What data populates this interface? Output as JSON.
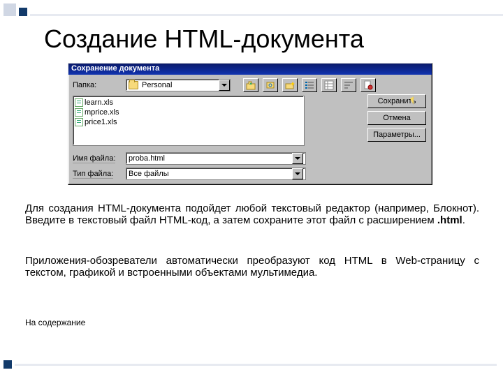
{
  "title": "Создание HTML-документа",
  "dialog": {
    "caption": "Сохранение документа",
    "folder_label": "Папка:",
    "folder_value": "Personal",
    "files": [
      "learn.xls",
      "mprice.xls",
      "price1.xls"
    ],
    "filename_label": "Имя файла:",
    "filename_value": "proba.html",
    "filetype_label": "Тип файла:",
    "filetype_value": "Все файлы",
    "buttons": {
      "save": "Сохранить",
      "cancel": "Отмена",
      "options": "Параметры..."
    },
    "toolbar_icons": [
      "up-folder-icon",
      "goto-icon",
      "new-folder-icon",
      "list-view-icon",
      "details-view-icon",
      "sort-icon",
      "properties-icon"
    ]
  },
  "paragraph1_a": "Для создания HTML-документа подойдет любой текстовый редактор (например, Блокнот). Введите в текстовый файл HTML-код, а затем сохраните этот файл с расширением ",
  "paragraph1_b": ".html",
  "paragraph1_c": ".",
  "paragraph2": "Приложения-обозреватели автоматически преобразуют код HTML в Web-страницу с текстом, графикой и встроенными объектами мультимедиа.",
  "contents_link": "На содержание"
}
